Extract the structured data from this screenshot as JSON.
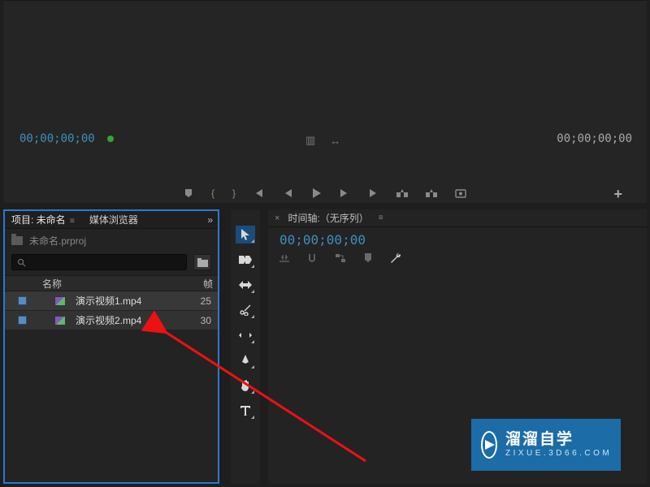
{
  "preview": {
    "timecode_left": "00;00;00;00",
    "timecode_right": "00;00;00;00"
  },
  "project_panel": {
    "tab_project_label": "项目: 未命名",
    "tab_media_label": "媒体浏览器",
    "project_file": "未命名.prproj",
    "col_name": "名称",
    "col_rate": "帧",
    "items": [
      {
        "name": "演示视频1.mp4",
        "rate": "25"
      },
      {
        "name": "演示视频2.mp4",
        "rate": "30"
      }
    ]
  },
  "timeline": {
    "tab_label": "时间轴:（无序列）",
    "timecode": "00;00;00;00"
  },
  "watermark": {
    "title": "溜溜自学",
    "url": "ZIXUE.3D66.COM"
  }
}
